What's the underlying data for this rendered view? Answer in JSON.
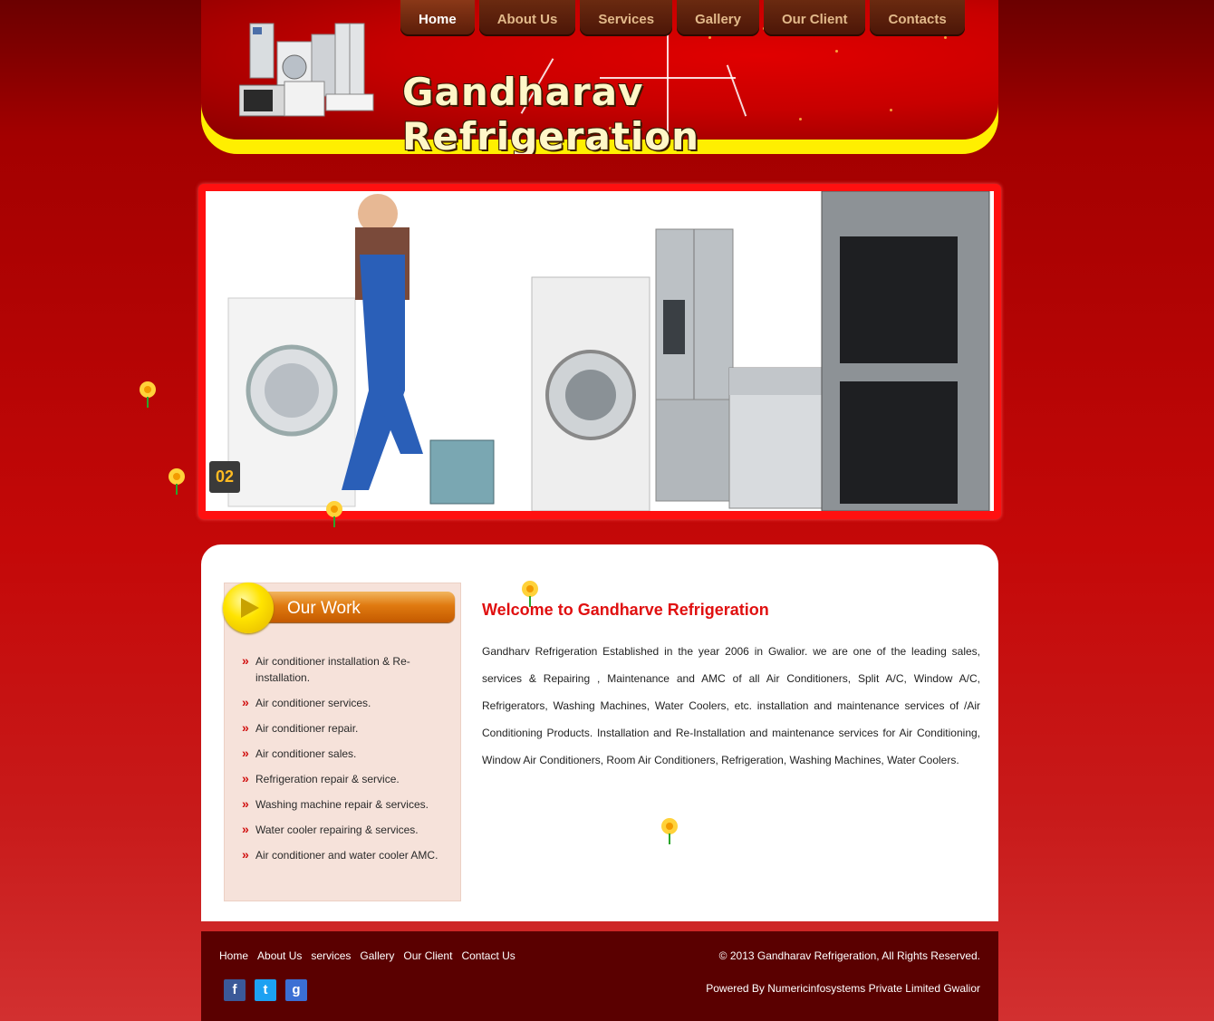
{
  "site": {
    "title": "Gandharav Refrigeration"
  },
  "nav": {
    "items": [
      {
        "label": "Home"
      },
      {
        "label": "About Us"
      },
      {
        "label": "Services"
      },
      {
        "label": "Gallery"
      },
      {
        "label": "Our Client"
      },
      {
        "label": "Contacts"
      }
    ]
  },
  "banner": {
    "slide_number": "02"
  },
  "sidebar": {
    "title": "Our Work",
    "items": [
      "Air conditioner installation & Re-installation.",
      "Air conditioner services.",
      "Air conditioner repair.",
      "Air conditioner sales.",
      "Refrigeration repair & service.",
      "Washing machine repair & services.",
      "Water cooler repairing & services.",
      "Air conditioner and water cooler AMC."
    ]
  },
  "main": {
    "welcome_title": "Welcome to Gandharve Refrigeration",
    "welcome_text": "Gandharv Refrigeration Established in the year 2006 in Gwalior. we are one of the leading sales, services & Repairing , Maintenance and AMC of all Air Conditioners, Split A/C, Window A/C, Refrigerators, Washing Machines, Water Coolers, etc. installation and maintenance services of /Air Conditioning Products. Installation and Re-Installation and maintenance services for Air Conditioning, Window Air Conditioners, Room Air Conditioners, Refrigeration, Washing Machines, Water Coolers."
  },
  "footer": {
    "links": [
      "Home",
      "About Us",
      "services",
      "Gallery",
      "Our Client",
      "Contact Us"
    ],
    "copyright": "© 2013 Gandharav Refrigeration, All Rights Reserved.",
    "powered_by": "Powered By Numericinfosystems Private Limited Gwalior",
    "social": [
      {
        "icon": "facebook-icon",
        "glyph": "f",
        "color": "#3b5998"
      },
      {
        "icon": "twitter-icon",
        "glyph": "t",
        "color": "#1da1f2"
      },
      {
        "icon": "google-plus-icon",
        "glyph": "g",
        "color": "#3b6fd4"
      }
    ]
  },
  "colors": {
    "brand_red": "#c40808",
    "accent_yellow": "#ffef00",
    "heading_red": "#e01010"
  }
}
